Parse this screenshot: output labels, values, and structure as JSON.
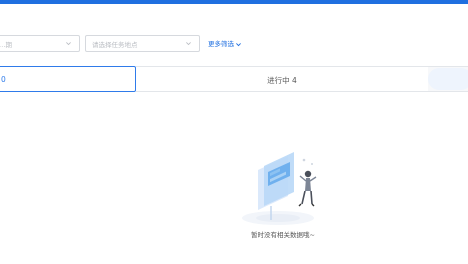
{
  "filters": {
    "first_placeholder": "…期",
    "second_placeholder": "请选择任务地点"
  },
  "more_filter_label": "更多筛选",
  "tabs": [
    {
      "label": "0",
      "active": true
    },
    {
      "label": "进行中 4",
      "active": false
    },
    {
      "label": "",
      "active": false
    }
  ],
  "empty_state": {
    "message": "暂时没有相关数据哦~"
  },
  "colors": {
    "accent": "#1f6fe0",
    "active_tab_border": "#2f7bea"
  },
  "icons": {
    "dropdown": "chevron-down-icon",
    "empty": "empty-data-illustration"
  }
}
